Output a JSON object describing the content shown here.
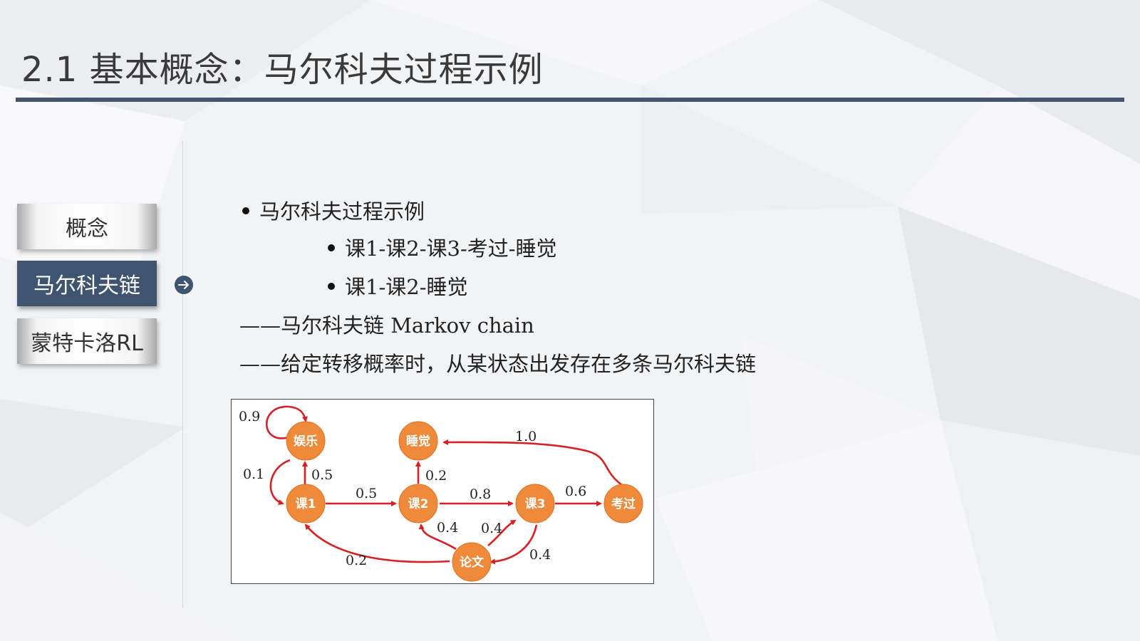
{
  "title": "2.1 基本概念：马尔科夫过程示例",
  "nav": [
    {
      "label": "概念",
      "active": false
    },
    {
      "label": "马尔科夫链",
      "active": true
    },
    {
      "label": "蒙特卡洛RL",
      "active": false
    }
  ],
  "content": {
    "heading": "马尔科夫过程示例",
    "examples": [
      "课1-课2-课3-考过-睡觉",
      "课1-课2-睡觉"
    ],
    "notes": [
      "——马尔科夫链 Markov chain",
      "——给定转移概率时，从某状态出发存在多条马尔科夫链"
    ]
  },
  "diagram": {
    "nodes": {
      "yule": "娱乐",
      "shuijiao": "睡觉",
      "ke1": "课1",
      "ke2": "课2",
      "ke3": "课3",
      "kaoguo": "考过",
      "lunwen": "论文"
    },
    "edges": [
      {
        "from": "娱乐",
        "to": "娱乐",
        "p": "0.9"
      },
      {
        "from": "娱乐",
        "to": "课1",
        "p": "0.1"
      },
      {
        "from": "课1",
        "to": "娱乐",
        "p": "0.5"
      },
      {
        "from": "课1",
        "to": "课2",
        "p": "0.5"
      },
      {
        "from": "课2",
        "to": "睡觉",
        "p": "0.2"
      },
      {
        "from": "课2",
        "to": "课3",
        "p": "0.8"
      },
      {
        "from": "课3",
        "to": "考过",
        "p": "0.6"
      },
      {
        "from": "考过",
        "to": "睡觉",
        "p": "1.0"
      },
      {
        "from": "论文",
        "to": "课2",
        "p": "0.4"
      },
      {
        "from": "论文",
        "to": "课3",
        "p": "0.4"
      },
      {
        "from": "论文",
        "to": "课1",
        "p": "0.2"
      },
      {
        "from": "课3",
        "to": "论文",
        "p": "0.4"
      }
    ],
    "colors": {
      "node": "#ee8a3a",
      "edge": "#d81f26"
    }
  },
  "colors": {
    "accent": "#3e5470",
    "rule": "#44566c"
  },
  "icons": {
    "nav_arrow": "arrow-right-circle-icon"
  }
}
